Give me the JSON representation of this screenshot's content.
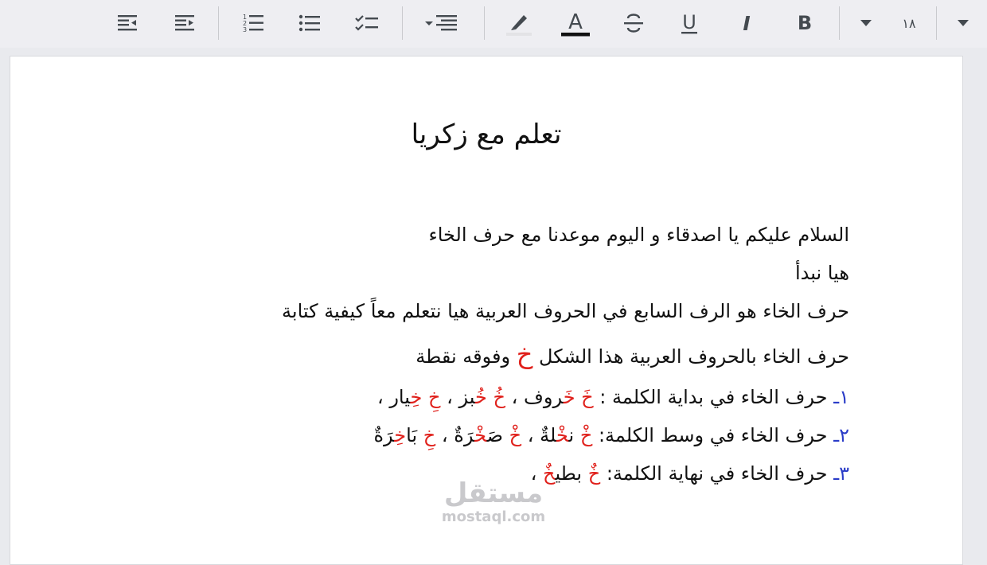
{
  "toolbar": {
    "font_size": "١٨",
    "buttons": [
      "indent-decrease",
      "indent-increase",
      "numbered-list",
      "bulleted-list",
      "checklist",
      "align-dropdown",
      "highlight",
      "text-color",
      "strikethrough",
      "underline",
      "italic",
      "bold",
      "font-size-dropdown",
      "more-dropdown"
    ],
    "bold_label": "B",
    "italic_label": "I",
    "underline_label": "U",
    "text_color_label": "A"
  },
  "colors": {
    "toolbar_bg": "#eeeef2",
    "page_bg": "#ffffff",
    "accent_red": "#e0201b",
    "list_number_blue": "#2a3cc8"
  },
  "document": {
    "title": "تعلم مع زكريا",
    "p1": "السلام عليكم يا اصدقاء و اليوم موعدنا مع حرف الخاء",
    "p2": "هيا نبدأ",
    "p3": "حرف الخاء هو الرف السابع في الحروف العربية هيا نتعلم معاً كيفية كتابة",
    "p4": {
      "before": "حرف الخاء بالحروف العربية هذا الشكل ",
      "letter": "خ",
      "after": " وفوقه نقطة"
    },
    "list": [
      {
        "num": "١ـ",
        "label": " حرف الخاء في بداية الكلمة : ",
        "words": [
          {
            "letter": "خَ",
            "word_red": "خَ",
            "word_rest": "روف"
          },
          {
            "letter": "خُ",
            "word_red": "خُ",
            "word_rest": "بز"
          },
          {
            "letter": "خِ",
            "word_red": "خِ",
            "word_rest": "يار"
          }
        ]
      },
      {
        "num": "٢ـ",
        "label": " حرف الخاء في وسط الكلمة: ",
        "words": [
          {
            "letter": "خْ",
            "pre": "ن",
            "word_red": "خْ",
            "post": "لةٌ"
          },
          {
            "letter": "خْ",
            "pre": "صَ",
            "word_red": "خْ",
            "post": "رَةٌ"
          },
          {
            "letter": "خِ",
            "pre": "بَا",
            "word_red": "خِ",
            "post": "رَةٌ"
          }
        ]
      },
      {
        "num": "٣ـ",
        "label": " حرف الخاء في نهاية الكلمة: ",
        "words": [
          {
            "letter": "خٌ",
            "pre": "بطي",
            "word_red": "خٌ",
            "post": ""
          }
        ]
      }
    ]
  },
  "watermark": {
    "arabic": "مستقل",
    "latin": "mostaql.com"
  }
}
